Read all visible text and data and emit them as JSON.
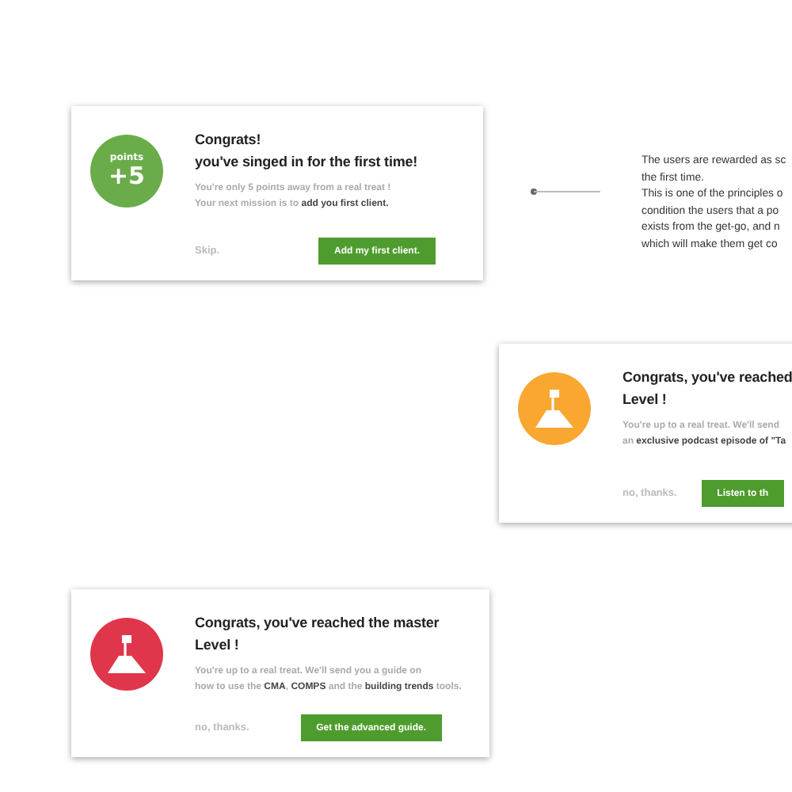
{
  "cards": [
    {
      "badge": {
        "kind": "points",
        "label": "points",
        "value": "+5"
      },
      "color": "#6aac4a",
      "title_lines": [
        "Congrats!",
        "you've singed in for the first time!"
      ],
      "body_lines": [
        "You're only 5 points away from a real treat !",
        "Your next mission is to **add you first client.**"
      ],
      "dismiss": "Skip.",
      "action": "Add my first client."
    },
    {
      "badge": {
        "kind": "flag"
      },
      "color": "#f9a730",
      "title_lines": [
        "Congrats, you've reached",
        "Level !"
      ],
      "body_lines": [
        "You're up to a real treat. We'll send",
        "an **exclusive podcast episode of \"Ta**"
      ],
      "dismiss": "no, thanks.",
      "action": "Listen to th"
    },
    {
      "badge": {
        "kind": "flag"
      },
      "color": "#e0364b",
      "title_lines": [
        "Congrats, you've reached the master",
        "Level !"
      ],
      "body_lines": [
        "You're up to a real treat. We'll send you a guide on",
        "how to use the **CMA**, **COMPS** and the **building trends** tools."
      ],
      "dismiss": "no, thanks.",
      "action": "Get the advanced guide."
    }
  ],
  "note": {
    "lines": [
      "The users are rewarded as sc",
      "the first time.",
      "This is one of the principles o",
      "condition the users that a po",
      "exists from the get-go, and n",
      "which will make them get co"
    ]
  }
}
